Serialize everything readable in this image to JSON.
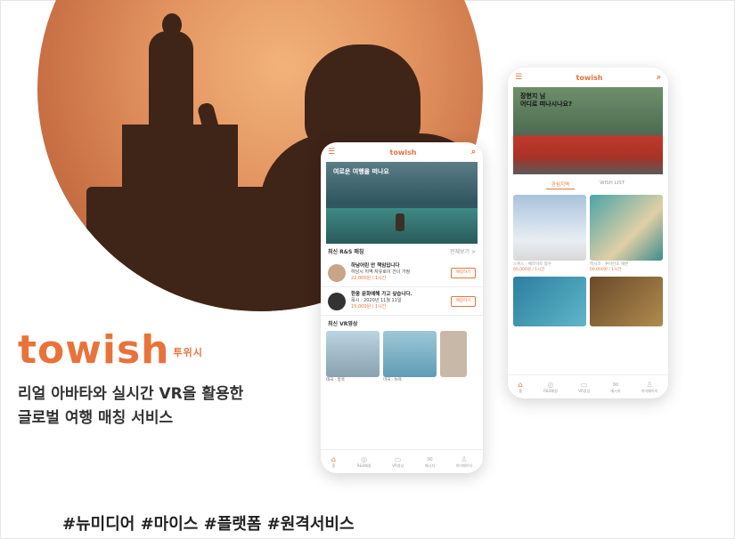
{
  "brand": {
    "logo": "towish",
    "logo_sub": "투위시"
  },
  "tagline": {
    "line1": "리얼 아바타와 실시간 VR을 활용한",
    "line2": "글로벌 여행 매칭 서비스"
  },
  "hashtags": "#뉴미디어 #마이스 #플랫폼 #원격서비스",
  "phone_left": {
    "header_title": "towish",
    "hero_text": "여로운 여행을 떠나요",
    "section1_title": "최신 R&S 매칭",
    "section1_more": "전체보기 >",
    "cards": [
      {
        "title": "하남어린 안 책임입니다",
        "desc": "하남시 지역 자유로이 건너 가정",
        "price": "22,000원 / 1시간",
        "button": "매칭하기"
      },
      {
        "title": "한웅 문화예해 가고 싶습니다.",
        "desc": "목시 : 2020년 11월 11일",
        "price": "15,000원 / 1시간",
        "button": "매칭하기"
      }
    ],
    "section2_title": "최신 VR영상",
    "videos": [
      {
        "caption": "태국 · 방콕"
      },
      {
        "caption": "미국 · 뉴욕"
      }
    ],
    "tabs": [
      "홈",
      "R&S매칭",
      "VR영상",
      "메시지",
      "마이페이지"
    ]
  },
  "phone_right": {
    "header_title": "towish",
    "greeting": "장현지 님\n어디로 떠나시나요?",
    "segments": [
      "관심지역",
      "WISH LIST"
    ],
    "grid_items": [
      {
        "caption": "스위스 · 체르마트 봉우",
        "price": "00,000원 / 1시간"
      },
      {
        "caption": "멕시코 · 쿠이칸초 해변",
        "price": "00,000원 / 1시간"
      },
      {
        "caption": "",
        "price": ""
      },
      {
        "caption": "",
        "price": ""
      }
    ],
    "tabs": [
      "홈",
      "R&S매칭",
      "VR영상",
      "메시지",
      "마이페이지"
    ]
  },
  "colors": {
    "accent": "#e8733a",
    "sun": "#e39561",
    "silhouette": "#3f2418"
  }
}
